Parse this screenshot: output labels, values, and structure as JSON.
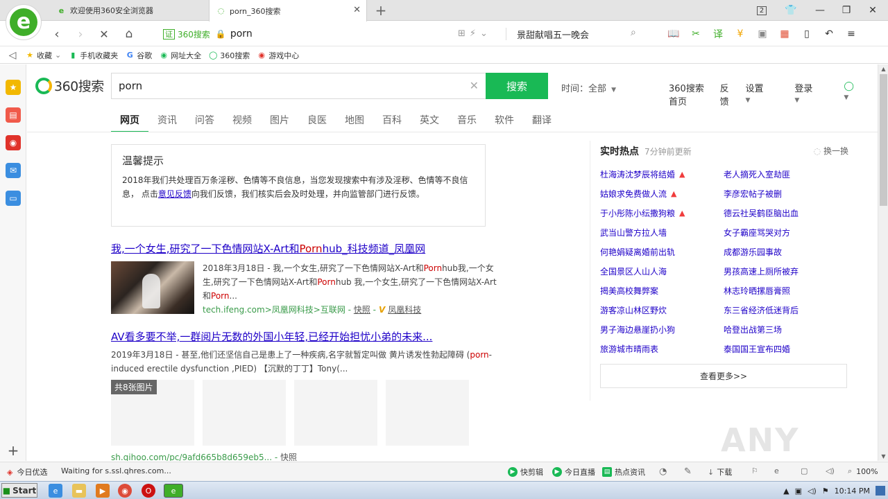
{
  "browser": {
    "tabs": [
      {
        "title": "欢迎使用360安全浏览器"
      },
      {
        "title": "porn_360搜索"
      }
    ],
    "address": {
      "cert_label": "证",
      "site_label": "360搜索",
      "url": "porn",
      "hot_search": "景甜献唱五一晚会"
    },
    "bookmarks": [
      {
        "label": "收藏",
        "icon": "star-icon"
      },
      {
        "label": "手机收藏夹",
        "icon": "phone-icon"
      },
      {
        "label": "谷歌",
        "icon": "google-icon"
      },
      {
        "label": "网址大全",
        "icon": "globe-icon"
      },
      {
        "label": "360搜索",
        "icon": "360-search-icon"
      },
      {
        "label": "游戏中心",
        "icon": "game-icon"
      }
    ],
    "tab_count": "2"
  },
  "search": {
    "logo_text": "360搜索",
    "query": "porn",
    "button": "搜索",
    "time_filter": "时间：全部",
    "top_links": [
      "360搜索首页",
      "反馈",
      "设置",
      "登录"
    ],
    "tabs": [
      "网页",
      "资讯",
      "问答",
      "视频",
      "图片",
      "良医",
      "地图",
      "百科",
      "英文",
      "音乐",
      "软件",
      "翻译"
    ]
  },
  "notice": {
    "title": "温馨提示",
    "text_before": "2018年我们共处理百万条淫秽、色情等不良信息，当您发现搜索中有涉及淫秽、色情等不良信息，  点击",
    "link": "意见反馈",
    "text_after": "向我们反馈，我们核实后会及时处理，并向监管部门进行反馈。"
  },
  "results": [
    {
      "title_a": "我,一个女生,研究了一下色情网站X-Art和",
      "title_hl": "Porn",
      "title_b": "hub_科技频道_凤凰网",
      "snippet_a": "2018年3月18日 - 我,一个女生,研究了一下色情网站X-Art和",
      "snippet_hl1": "Porn",
      "snippet_b": "hub我,一个女生,研究了一下色情网站X-Art和",
      "snippet_hl2": "Porn",
      "snippet_c": "hub 我,一个女生,研究了一下色情网站X-Art和",
      "snippet_hl3": "Porn",
      "snippet_d": "...",
      "url": "tech.ifeng.com>凤凰网科技>互联网",
      "snapshot": "快照",
      "source": "凤凰科技"
    },
    {
      "title": "AV看多要不举,一群阅片无数的外国小年轻,已经开始担忧小弟的未来...",
      "snippet_a": "2019年3月18日 - 甚至,他们还坚信自己是患上了一种疾病,名字就暂定叫做 黄片诱发性勃起障碍 (",
      "snippet_hl": "porn",
      "snippet_b": "-induced erectile dysfunction ,PIED) 【沉默的丁丁】Tony(...",
      "image_count": "共8张图片",
      "url": "sh.qihoo.com/pc/9afd665b8d659eb5...",
      "snapshot": "快照"
    }
  ],
  "hot": {
    "title": "实时热点",
    "updated": "7分钟前更新",
    "refresh": "换一换",
    "items": [
      {
        "text": "杜海涛沈梦辰将结婚",
        "rising": true
      },
      {
        "text": "老人摘死入室劫匪",
        "rising": false
      },
      {
        "text": "姑娘求免费做人流",
        "rising": true
      },
      {
        "text": "李彦宏帖子被删",
        "rising": false
      },
      {
        "text": "于小彤陈小纭撒狗粮",
        "rising": true
      },
      {
        "text": "德云社吴鹤臣脑出血",
        "rising": false
      },
      {
        "text": "武当山警方拉人墙",
        "rising": false
      },
      {
        "text": "女子霸座骂哭对方",
        "rising": false
      },
      {
        "text": "何艳娟疑离婚前出轨",
        "rising": false
      },
      {
        "text": "成都游乐园事故",
        "rising": false
      },
      {
        "text": "全国景区人山人海",
        "rising": false
      },
      {
        "text": "男孩高速上厕所被弃",
        "rising": false
      },
      {
        "text": "揭美高校舞弊案",
        "rising": false
      },
      {
        "text": "林志玲晒摞唇膏照",
        "rising": false
      },
      {
        "text": "游客凉山林区野炊",
        "rising": false
      },
      {
        "text": "东三省经济低迷背后",
        "rising": false
      },
      {
        "text": "男子海边悬崖扔小狗",
        "rising": false
      },
      {
        "text": "哈登出战第三场",
        "rising": false
      },
      {
        "text": "旅游城市晴雨表",
        "rising": false
      },
      {
        "text": "泰国国王宣布四婚",
        "rising": false
      }
    ],
    "more": "查看更多>>"
  },
  "watermark": "ANY RUN",
  "status": {
    "today": "今日优选",
    "loading": "Waiting for s.ssl.qhres.com...",
    "items": [
      "快剪辑",
      "今日直播",
      "热点资讯"
    ],
    "download": "下载",
    "zoom": "100%"
  },
  "taskbar": {
    "start": "Start",
    "clock": "10:14 PM"
  }
}
